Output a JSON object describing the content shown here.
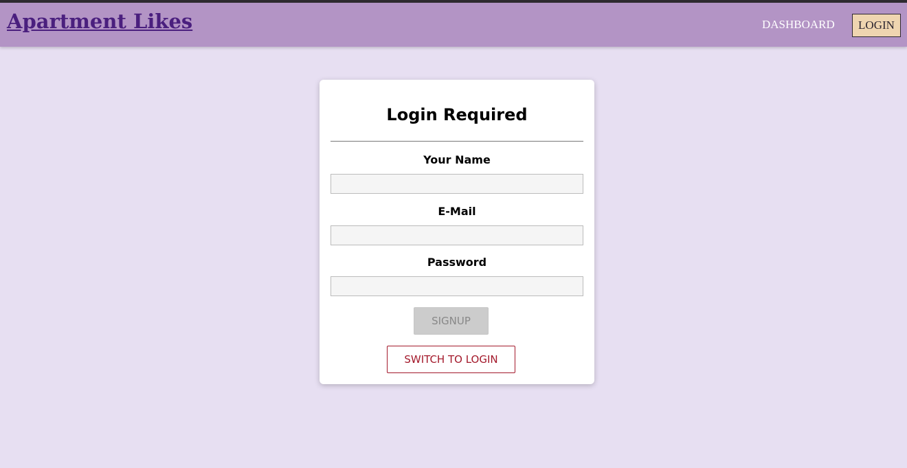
{
  "header": {
    "brand": "Apartment Likes",
    "nav": {
      "dashboard": "DASHBOARD",
      "login": "LOGIN"
    }
  },
  "auth_card": {
    "title": "Login Required",
    "fields": {
      "name": {
        "label": "Your Name",
        "value": "",
        "placeholder": ""
      },
      "email": {
        "label": "E-Mail",
        "value": "",
        "placeholder": ""
      },
      "password": {
        "label": "Password",
        "value": "",
        "placeholder": ""
      }
    },
    "signup_label": "SIGNUP",
    "switch_label": "SWITCH TO LOGIN"
  },
  "colors": {
    "page_background": "#e7dff2",
    "header_background": "#b394c5",
    "brand": "#4a1f7e",
    "login_button_background": "#efd5b0",
    "accent_red": "#a3182a",
    "disabled_button": "#cccccc"
  }
}
